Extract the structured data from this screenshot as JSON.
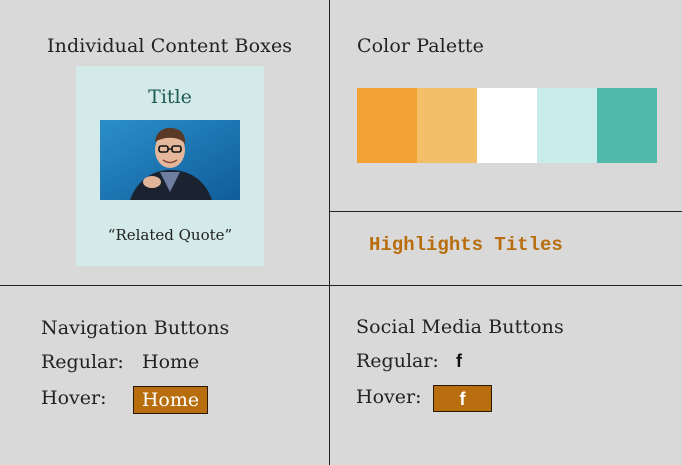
{
  "content_boxes": {
    "heading": "Individual Content Boxes",
    "box_title": "Title",
    "quote": "“Related Quote”"
  },
  "palette": {
    "heading": "Color Palette",
    "colors": [
      "#f1a232",
      "#f3bf69",
      "#ffffff",
      "#c9eceb",
      "#52b9ad"
    ]
  },
  "highlights": {
    "label": "Highlights Titles",
    "color": "#b86e0e"
  },
  "navigation": {
    "heading": "Navigation Buttons",
    "regular_label": "Regular:",
    "hover_label": "Hover:",
    "home_label": "Home",
    "hover_bg": "#b86e0e"
  },
  "social": {
    "heading": "Social Media Buttons",
    "regular_label": "Regular:",
    "hover_label": "Hover:",
    "icon": "facebook-icon"
  }
}
